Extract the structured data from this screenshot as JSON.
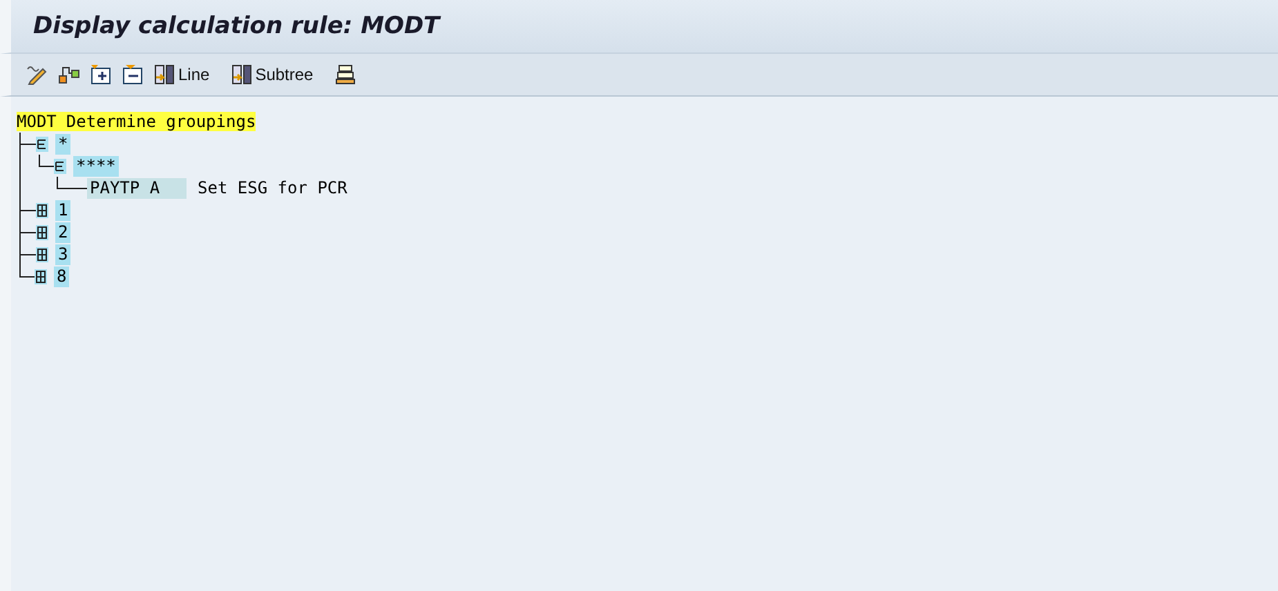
{
  "window": {
    "title": "Display calculation rule: MODT"
  },
  "toolbar": {
    "buttons": [
      {
        "kind": "edit"
      },
      {
        "kind": "hierarchy"
      },
      {
        "kind": "expand"
      },
      {
        "kind": "collapse"
      },
      {
        "kind": "line",
        "label": "Line"
      },
      {
        "kind": "subtree",
        "label": "Subtree"
      },
      {
        "kind": "stack"
      }
    ]
  },
  "tree": {
    "root": {
      "label": "MODT",
      "description": "Determine groupings"
    },
    "children": [
      {
        "kind": "group",
        "label": "*",
        "expanded": true,
        "children": [
          {
            "kind": "group",
            "label": "****",
            "expanded": true,
            "children": [
              {
                "kind": "operation",
                "label": "PAYTP A",
                "description": "Set ESG for PCR"
              }
            ]
          }
        ]
      },
      {
        "kind": "group",
        "label": "1",
        "expanded": false
      },
      {
        "kind": "group",
        "label": "2",
        "expanded": false
      },
      {
        "kind": "group",
        "label": "3",
        "expanded": false
      },
      {
        "kind": "group",
        "label": "8",
        "expanded": false
      }
    ]
  }
}
